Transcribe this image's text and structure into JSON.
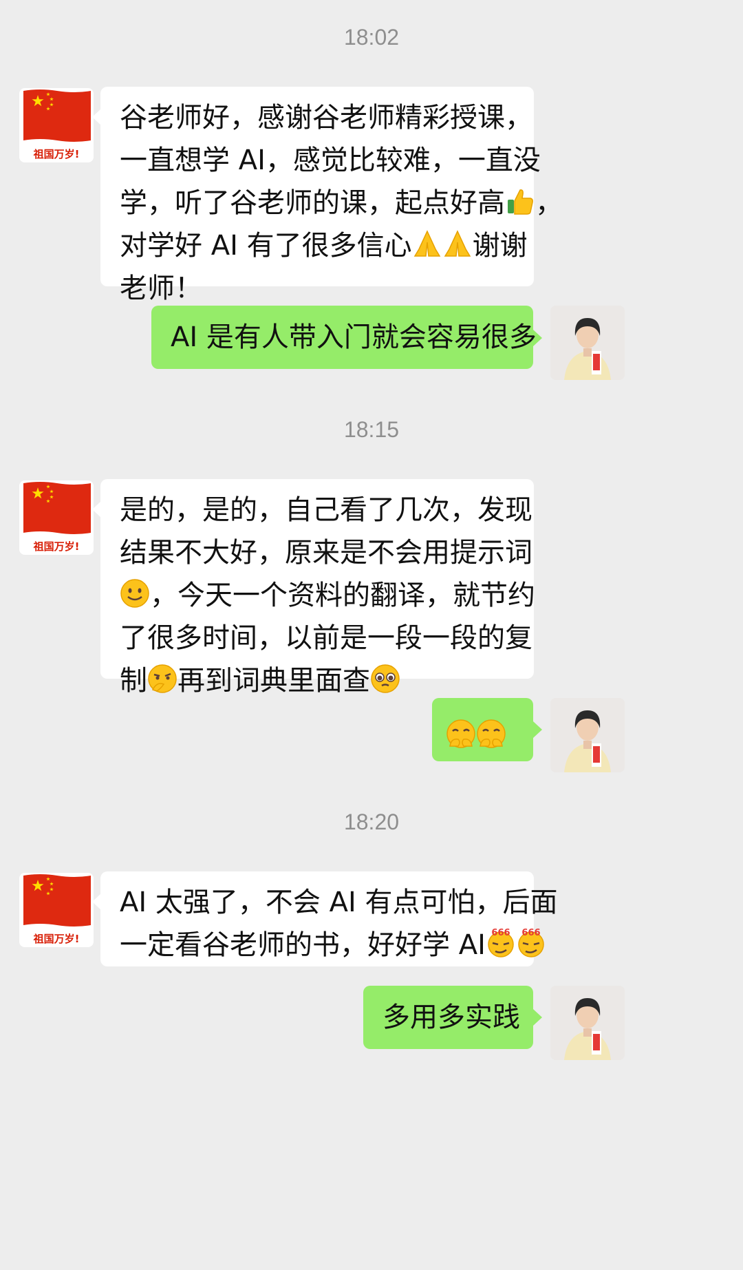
{
  "messages": [
    {
      "time": "18:02"
    },
    {
      "in_1": [
        "谷老师好，感谢谷老师精彩授课，",
        "一直想学 AI，感觉比较难，一直没",
        "学，听了谷老师的课，起点好高",
        "，",
        "对学好 AI 有了很多信心",
        "谢谢",
        "老师！"
      ]
    },
    {
      "out_1": "AI 是有人带入门就会容易很多"
    },
    {
      "time": "18:15"
    },
    {
      "in_2": [
        "是的，是的，自己看了几次，发现",
        "结果不大好，原来是不会用提示词",
        "，今天一个资料的翻译，就节约",
        "了很多时间，以前是一段一段的复",
        "制",
        "再到词典里面查"
      ]
    },
    {
      "time": "18:20"
    },
    {
      "in_3": [
        "AI 太强了，不会 AI 有点可怕，后面",
        "一定看谷老师的书，好好学 AI"
      ]
    },
    {
      "out_3": "多用多实践"
    }
  ],
  "timestamps": [
    "18:02",
    "18:15",
    "18:20"
  ],
  "contact_avatar_caption": "祖国万岁!",
  "emoji_names": [
    "thumbs-up-icon",
    "pray-icon",
    "smile-icon",
    "thinking-icon",
    "pleading-icon",
    "giggle-icon",
    "666-icon"
  ],
  "colors": {
    "background": "#ededed",
    "incoming_bubble": "#ffffff",
    "outgoing_bubble": "#95ec69",
    "timestamp": "#8e8e8e",
    "flag_red": "#de2910",
    "flag_star": "#ffde00"
  }
}
